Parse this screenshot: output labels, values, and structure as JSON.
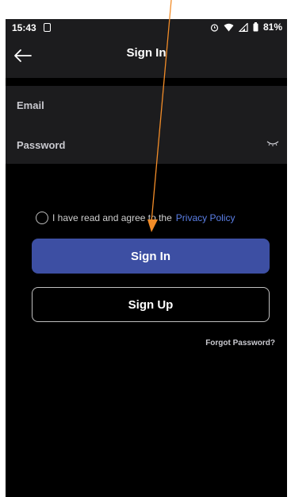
{
  "status_bar": {
    "time": "15:43",
    "battery": "81%",
    "icons": [
      "alarm-icon",
      "wifi-icon",
      "signal-icon",
      "battery-icon"
    ]
  },
  "header": {
    "title": "Sign In",
    "back_icon": "back-arrow-icon"
  },
  "form": {
    "email_placeholder": "Email",
    "email_value": "",
    "password_placeholder": "Password",
    "password_value": ""
  },
  "agreement": {
    "text": "I have read and agree to the",
    "link": "Privacy Policy",
    "checked": false
  },
  "buttons": {
    "sign_in": "Sign In",
    "sign_up": "Sign Up"
  },
  "forgot_password": "Forgot Password?",
  "colors": {
    "primary": "#3d4fa3",
    "link": "#5b7fe6",
    "panel": "#1c1c1e",
    "annotation_arrow": "#f28c28"
  }
}
